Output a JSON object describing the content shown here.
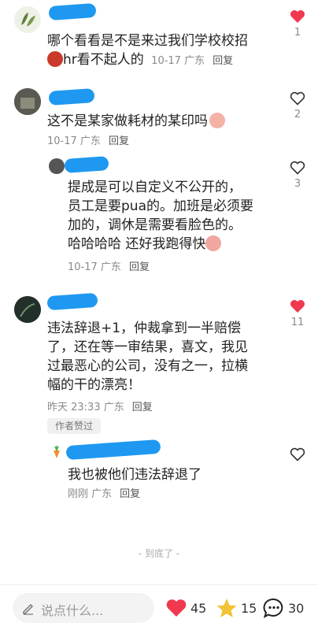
{
  "colors": {
    "like_active": "#f0384f",
    "redaction": "#1e98f0",
    "meta": "#8a8a8a"
  },
  "comments": [
    {
      "text_lines": [
        "哪个看看是不是来过我们学校校招",
        "hr看不起人的"
      ],
      "date": "10-17",
      "location": "广东",
      "reply_label": "回复",
      "likes": "1",
      "liked": true,
      "emoji": "angry-face-emoji"
    },
    {
      "text": "这不是某家做耗材的某印吗",
      "date": "10-17",
      "location": "广东",
      "reply_label": "回复",
      "likes": "2",
      "liked": false,
      "emoji": "peach-face-emoji",
      "replies": [
        {
          "text_lines": [
            "提成是可以自定义不公开的，",
            "员工是要pua的。加班是必须要",
            "加的，调休是需要看脸色的。",
            "哈哈哈哈 还好我跑得快"
          ],
          "date": "10-17",
          "location": "广东",
          "reply_label": "回复",
          "likes": "3",
          "liked": false,
          "emoji": "cool-face-emoji"
        }
      ]
    },
    {
      "text_lines": [
        "违法辞退+1，仲裁拿到一半赔偿",
        "了，还在等一审结果，喜文，我见",
        "过最恶心的公司，没有之一，拉横",
        "幅的干的漂亮！"
      ],
      "date": "昨天 23:33",
      "location": "广东",
      "reply_label": "回复",
      "likes": "11",
      "liked": true,
      "author_liked_tag": "作者赞过",
      "replies": [
        {
          "text": "我也被他们违法辞退了",
          "date": "刚刚",
          "location": "广东",
          "reply_label": "回复",
          "likes": "",
          "liked": false
        }
      ]
    }
  ],
  "end_label": "- 到底了 -",
  "bottom_bar": {
    "input_placeholder": "说点什么...",
    "likes": "45",
    "favorites": "15",
    "comments": "30"
  }
}
